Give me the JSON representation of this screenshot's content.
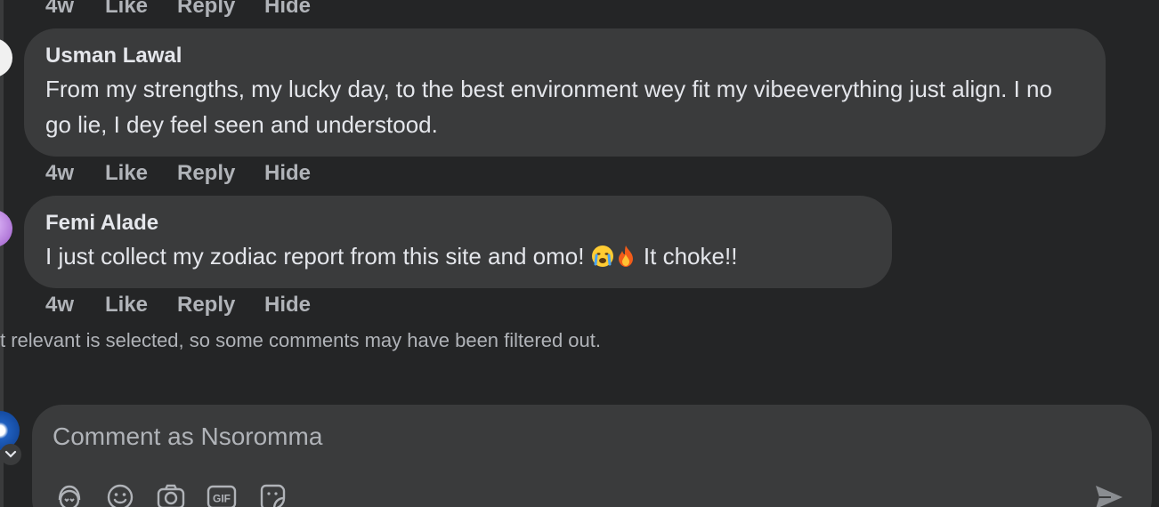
{
  "top_actions": {
    "time": "4w",
    "like": "Like",
    "reply": "Reply",
    "hide": "Hide"
  },
  "comments": [
    {
      "author": "Usman Lawal",
      "text": "From my strengths, my lucky day, to the best environment wey fit my vibeeverything just align. I no go lie, I dey feel seen and understood.",
      "actions": {
        "time": "4w",
        "like": "Like",
        "reply": "Reply",
        "hide": "Hide"
      }
    },
    {
      "author": "Femi Alade",
      "text_before": "I just collect my zodiac report from this site and omo!",
      "emojis": [
        "crying-face-emoji",
        "fire-emoji"
      ],
      "text_after": "It choke!!",
      "actions": {
        "time": "4w",
        "like": "Like",
        "reply": "Reply",
        "hide": "Hide"
      }
    }
  ],
  "filter_note": "t relevant is selected, so some comments may have been filtered out.",
  "composer": {
    "placeholder": "Comment as Nsoromma",
    "tools": [
      "avatar-sticker-icon",
      "emoji-icon",
      "camera-icon",
      "gif-icon",
      "sticker-icon"
    ],
    "gif_label": "GIF",
    "send_icon": "send-icon"
  },
  "colors": {
    "background": "#242526",
    "bubble": "#3a3b3c",
    "primary_text": "#e4e6eb",
    "secondary_text": "#b0b3b8"
  }
}
